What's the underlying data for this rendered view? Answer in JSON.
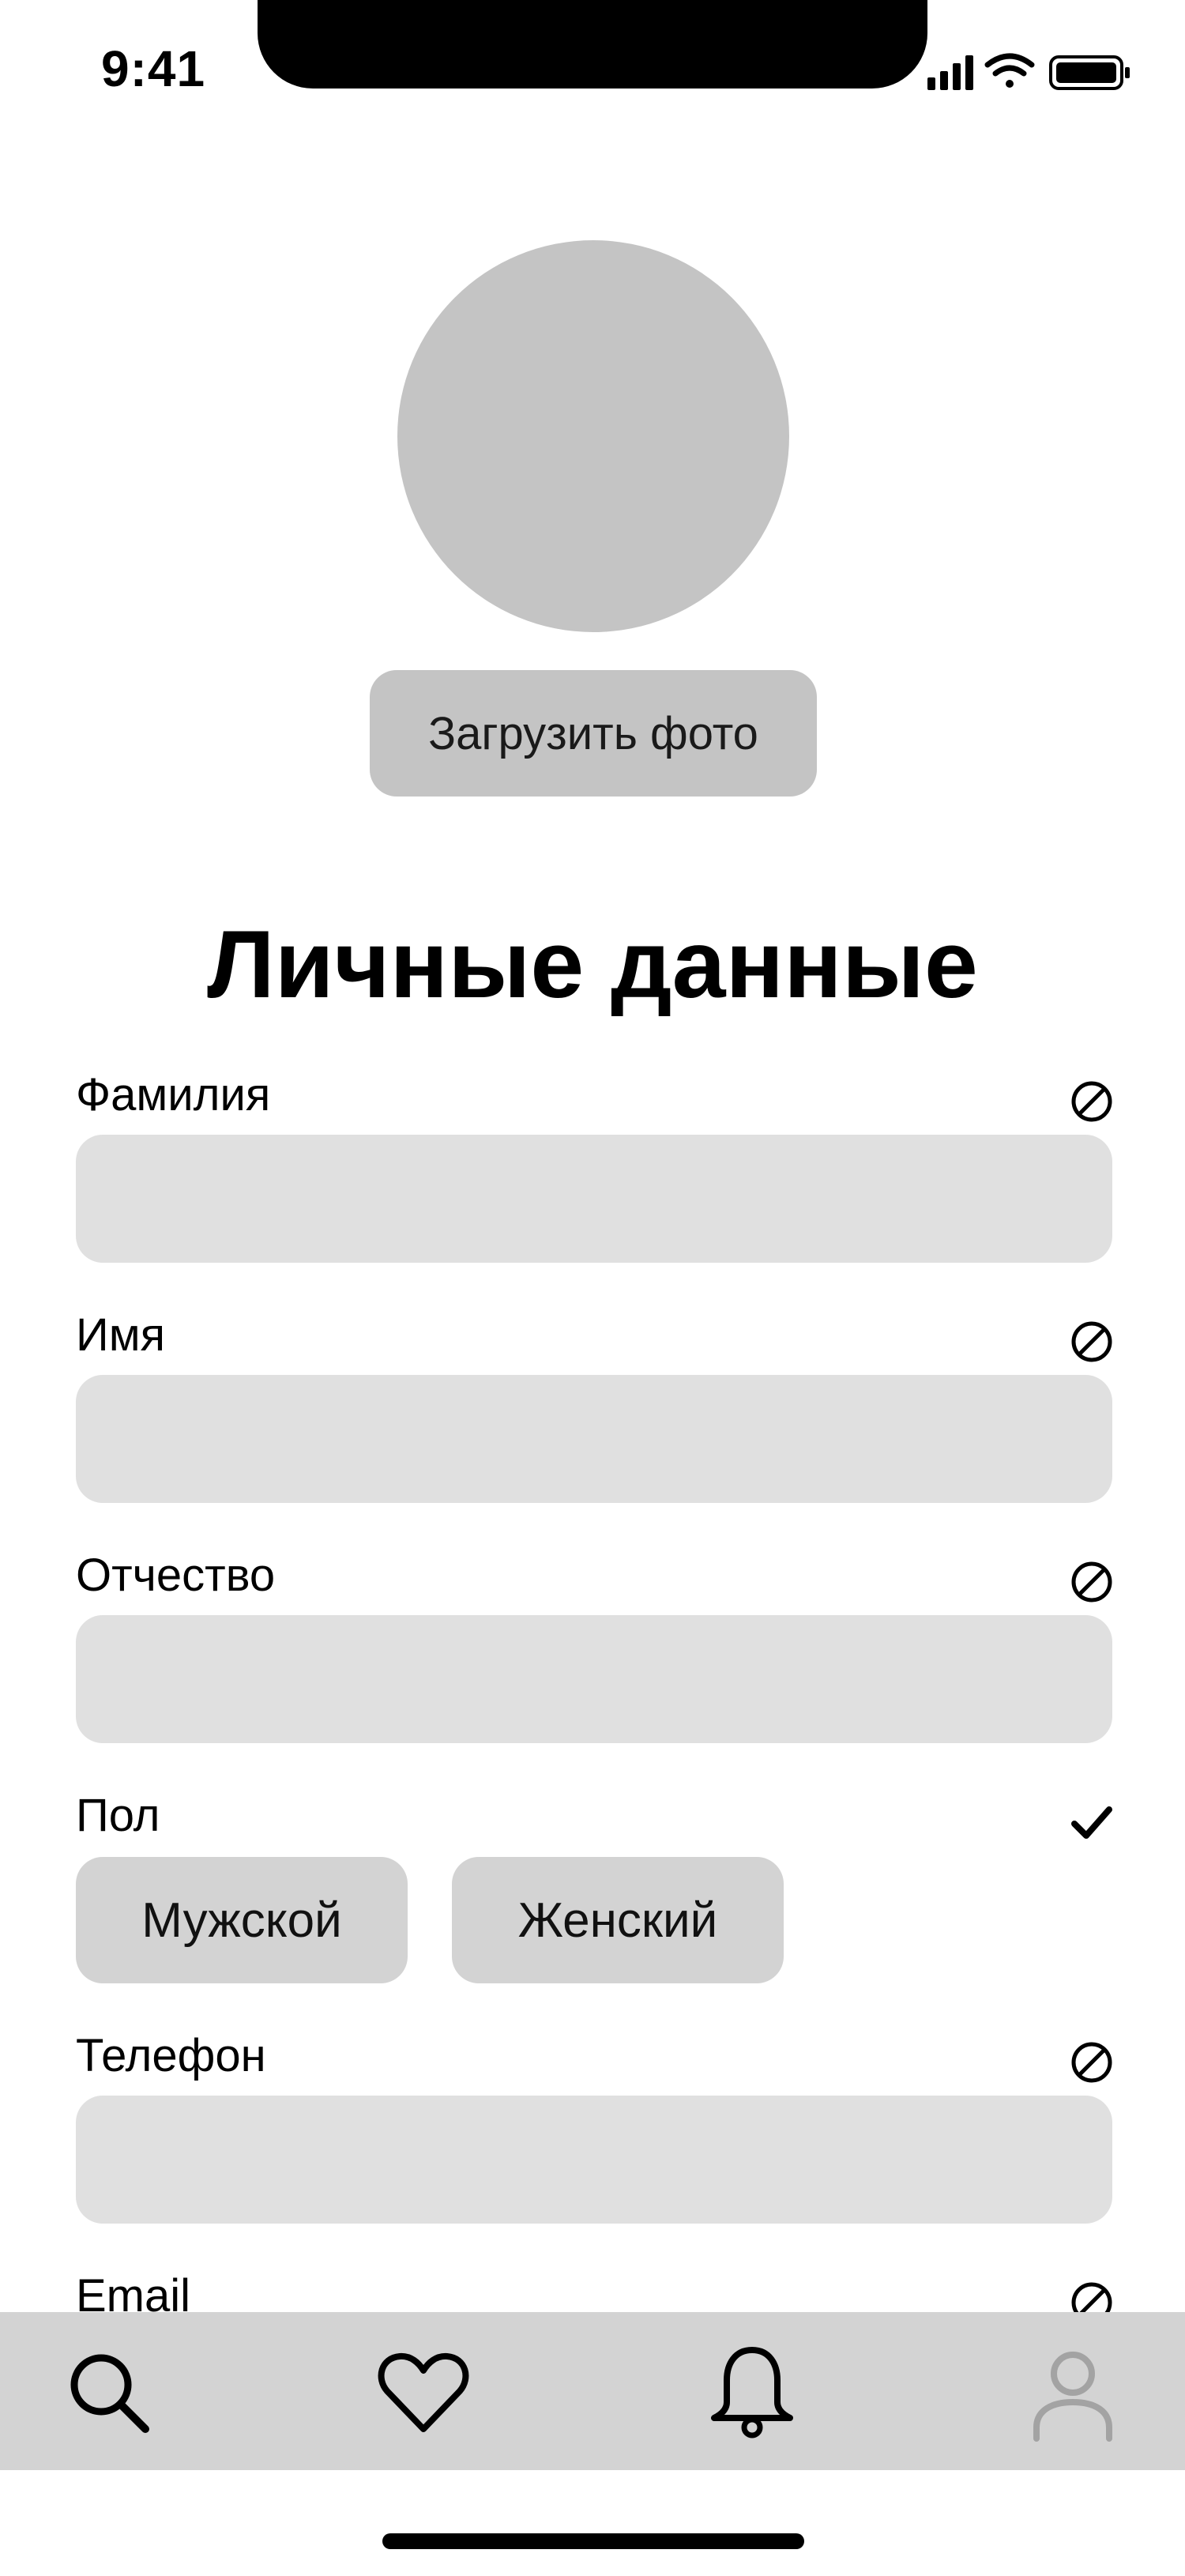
{
  "status_bar": {
    "time": "9:41",
    "icons": [
      "signal-icon",
      "wifi-icon",
      "battery-icon"
    ]
  },
  "profile": {
    "upload_photo_label": "Загрузить фото"
  },
  "page_title": "Личные данные",
  "form": {
    "fields": [
      {
        "label": "Фамилия",
        "value": "",
        "status": "not-set"
      },
      {
        "label": "Имя",
        "value": "",
        "status": "not-set"
      },
      {
        "label": "Отчество",
        "value": "",
        "status": "not-set"
      },
      {
        "label": "Телефон",
        "value": "",
        "status": "not-set"
      },
      {
        "label": "Email",
        "value": "",
        "status": "not-set"
      }
    ],
    "gender": {
      "label": "Пол",
      "status": "set",
      "options": [
        "Мужской",
        "Женский"
      ]
    }
  },
  "tab_bar": {
    "items": [
      {
        "icon": "search-icon",
        "active": true
      },
      {
        "icon": "heart-icon",
        "active": true
      },
      {
        "icon": "bell-icon",
        "active": true
      },
      {
        "icon": "profile-icon",
        "active": false
      }
    ]
  },
  "colors": {
    "avatar_placeholder": "#c4c4c4",
    "field_background": "#e0e0e0",
    "gender_button": "#d3d3d3",
    "tab_bar_background": "#d3d3d3",
    "inactive_icon": "#a3a3a3"
  }
}
